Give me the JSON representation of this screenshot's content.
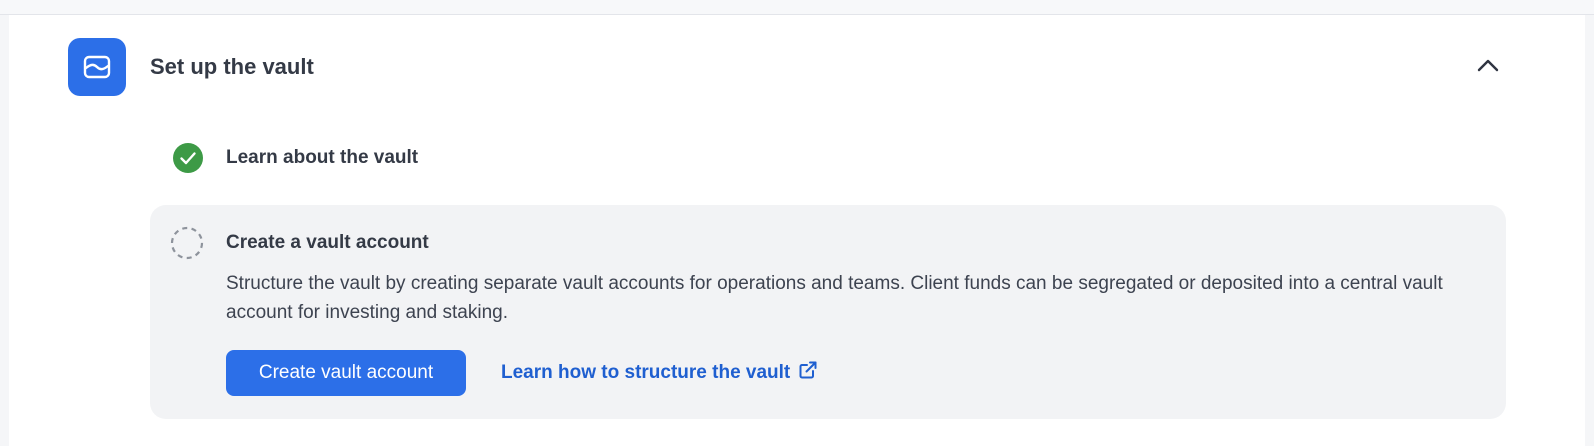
{
  "section": {
    "title": "Set up the vault",
    "icon": "vault-icon",
    "toggle_icon": "chevron-up-icon",
    "accent_color": "#2c6fe8"
  },
  "steps": [
    {
      "label": "Learn about the vault",
      "status": "completed",
      "icon": "check-circle-icon",
      "status_color": "#3d9a46"
    },
    {
      "label": "Create a vault account",
      "status": "pending",
      "icon": "dashed-circle-icon",
      "description": "Structure the vault by creating separate vault accounts for operations and teams. Client funds can be segregated or deposited into a central vault account for investing and staking.",
      "primary_button": "Create vault account",
      "link_text": "Learn how to structure the vault",
      "link_icon": "external-link-icon",
      "link_color": "#1f5fd0"
    }
  ]
}
